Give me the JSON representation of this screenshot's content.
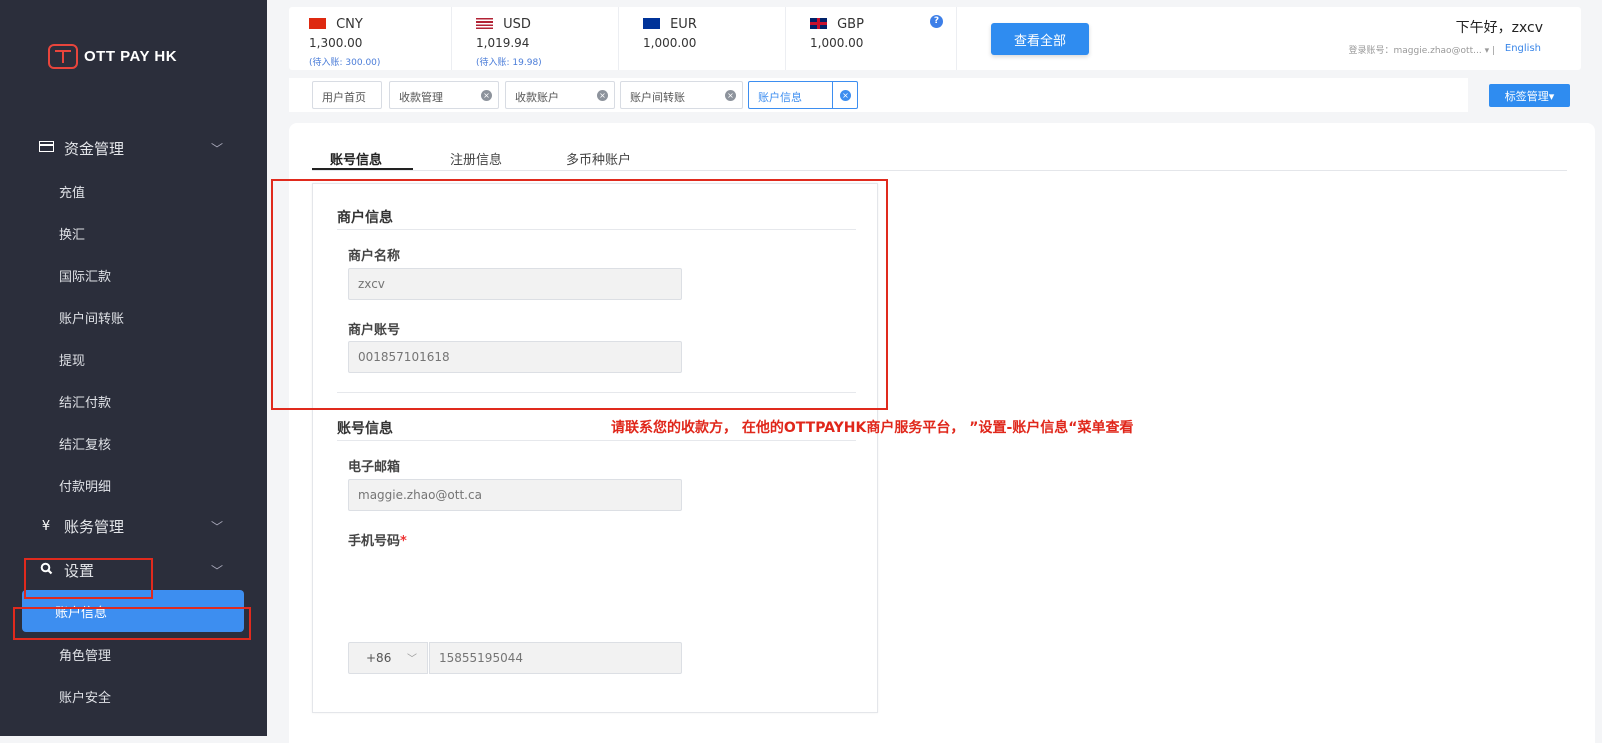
{
  "app": {
    "logo_text": "OTT PAY HK"
  },
  "sidebar": {
    "groups": [
      {
        "label": "资金管理",
        "icon": "card-icon"
      },
      {
        "label": "账务管理",
        "icon": "yen-icon"
      },
      {
        "label": "设置",
        "icon": "search-icon"
      }
    ],
    "fund_items": [
      "充值",
      "换汇",
      "国际汇款",
      "账户间转账",
      "提现",
      "结汇付款",
      "结汇复核",
      "付款明细"
    ],
    "settings_items": [
      "账户信息",
      "角色管理",
      "账户安全"
    ]
  },
  "balances": [
    {
      "code": "CNY",
      "amount": "1,300.00",
      "pending": "(待入账: 300.00)"
    },
    {
      "code": "USD",
      "amount": "1,019.94",
      "pending": "(待入账: 19.98)"
    },
    {
      "code": "EUR",
      "amount": "1,000.00",
      "pending": ""
    },
    {
      "code": "GBP",
      "amount": "1,000.00",
      "pending": ""
    }
  ],
  "header": {
    "help_glyph": "?",
    "view_all": "查看全部",
    "greeting": "下午好，zxcv",
    "login_account": "登录账号：maggie.zhao@ott...",
    "language": "English"
  },
  "tabs": {
    "items": [
      "用户首页",
      "收款管理",
      "收款账户",
      "账户间转账",
      "账户信息"
    ],
    "close_glyph": "×",
    "manage": "标签管理▾"
  },
  "page_tabs": [
    "账号信息",
    "注册信息",
    "多币种账户"
  ],
  "merchant": {
    "section_title": "商户信息",
    "name_label": "商户名称",
    "name_value": "zxcv",
    "account_label": "商户账号",
    "account_value": "001857101618"
  },
  "account": {
    "section_title": "账号信息",
    "email_label": "电子邮箱",
    "email_value": "maggie.zhao@ott.ca",
    "phone_label": "手机号码",
    "required_mark": "*",
    "country_code": "+86",
    "phone_value": "15855195044"
  },
  "annotation": "请联系您的收款方， 在他的OTTPAYHK商户服务平台， ”设置-账户信息“菜单查看",
  "colors": {
    "sidebar_bg": "#2b2e3b",
    "primary": "#2f8cf0",
    "annotation_red": "#e0271b"
  }
}
